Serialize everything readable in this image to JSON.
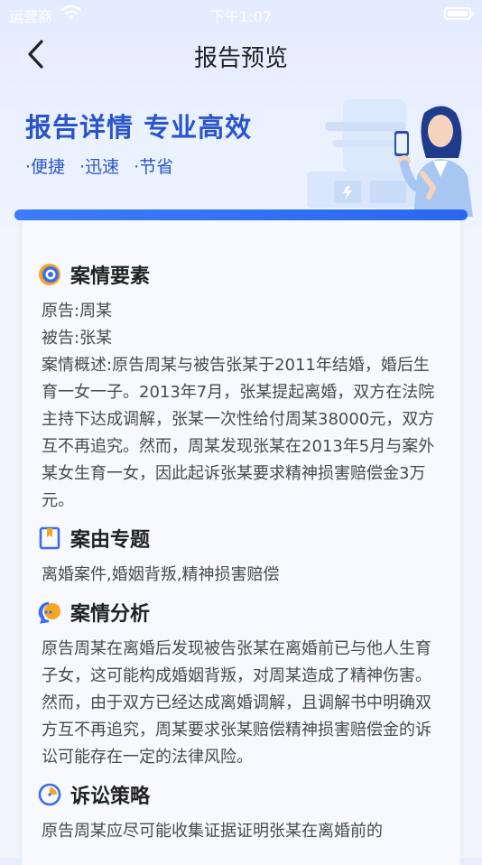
{
  "status_bar": {
    "carrier": "运营商",
    "time": "下午1:07"
  },
  "nav": {
    "title": "报告预览"
  },
  "hero": {
    "title": "报告详情 专业高效",
    "tags": [
      "·便捷",
      "·迅速",
      "·节省"
    ]
  },
  "sections": {
    "case_elements": {
      "heading": "案情要素",
      "plaintiff": "原告:周某",
      "defendant": "被告:张某",
      "summary": "案情概述:原告周某与被告张某于2011年结婚，婚后生育一女一子。2013年7月，张某提起离婚，双方在法院主持下达成调解，张某一次性给付周某38000元，双方互不再追究。然而，周某发现张某在2013年5月与案外某女生育一女，因此起诉张某要求精神损害赔偿金3万元。"
    },
    "case_topic": {
      "heading": "案由专题",
      "text": "离婚案件,婚姻背叛,精神损害赔偿"
    },
    "case_analysis": {
      "heading": "案情分析",
      "text": "原告周某在离婚后发现被告张某在离婚前已与他人生育子女，这可能构成婚姻背叛，对周某造成了精神伤害。然而，由于双方已经达成离婚调解，且调解书中明确双方互不再追究，周某要求张某赔偿精神损害赔偿金的诉讼可能存在一定的法律风险。"
    },
    "strategy": {
      "heading": "诉讼策略",
      "text": "原告周某应尽可能收集证据证明张某在离婚前的"
    }
  },
  "colors": {
    "accent": "#2a55c9",
    "bar": "#3d7cf6",
    "icon_orange": "#f5a623"
  }
}
